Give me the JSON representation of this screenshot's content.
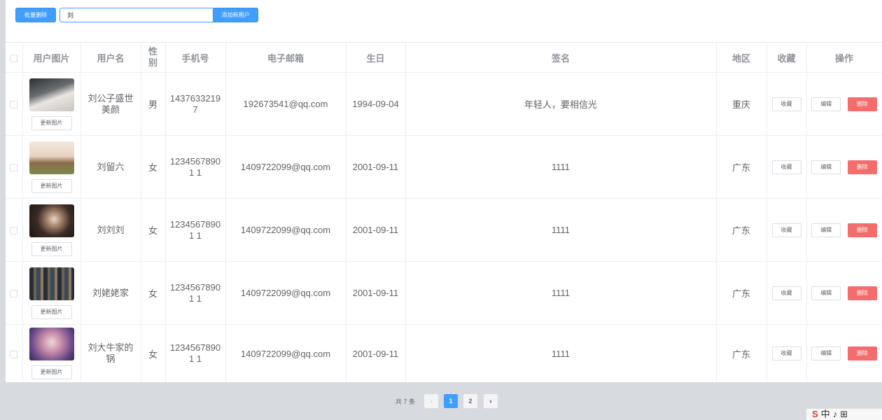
{
  "toolbar": {
    "batch_delete_label": "批量删除",
    "search_value": "刘",
    "add_user_label": "添加新用户"
  },
  "table": {
    "headers": {
      "photo": "用户图片",
      "username": "用户名",
      "gender": "性别",
      "phone": "手机号",
      "email": "电子邮箱",
      "birthday": "生日",
      "signature": "签名",
      "region": "地区",
      "favorite": "收藏",
      "actions": "操作"
    },
    "update_photo_label": "更新图片",
    "favorite_label": "收藏",
    "edit_label": "编辑",
    "delete_label": "删除",
    "rows": [
      {
        "username": "刘公子盛世美颜",
        "gender": "男",
        "phone": "14376332197",
        "email": "192673541@qq.com",
        "birthday": "1994-09-04",
        "signature": "年轻人，要相信光",
        "region": "重庆"
      },
      {
        "username": "刘留六",
        "gender": "女",
        "phone": "12345678901 1",
        "email": "1409722099@qq.com",
        "birthday": "2001-09-11",
        "signature": "1111",
        "region": "广东"
      },
      {
        "username": "刘刘刘",
        "gender": "女",
        "phone": "12345678901 1",
        "email": "1409722099@qq.com",
        "birthday": "2001-09-11",
        "signature": "1111",
        "region": "广东"
      },
      {
        "username": "刘姥姥家",
        "gender": "女",
        "phone": "12345678901 1",
        "email": "1409722099@qq.com",
        "birthday": "2001-09-11",
        "signature": "1111",
        "region": "广东"
      },
      {
        "username": "刘大牛家的锅",
        "gender": "女",
        "phone": "12345678901 1",
        "email": "1409722099@qq.com",
        "birthday": "2001-09-11",
        "signature": "1111",
        "region": "广东"
      }
    ]
  },
  "pagination": {
    "total_text": "共 7 条",
    "prev": "‹",
    "next": "›",
    "pages": [
      "1",
      "2"
    ],
    "current_page": "1"
  },
  "colors": {
    "primary": "#409eff",
    "danger": "#f56c6c"
  }
}
